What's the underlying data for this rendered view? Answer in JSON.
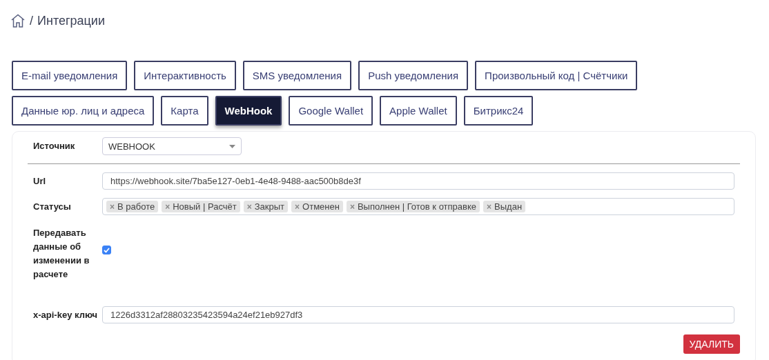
{
  "breadcrumb": {
    "separator": "/",
    "title": "Интеграции"
  },
  "tabs": [
    {
      "label": "E-mail уведомления",
      "selected": false
    },
    {
      "label": "Интерактивность",
      "selected": false
    },
    {
      "label": "SMS уведомления",
      "selected": false
    },
    {
      "label": "Push уведомления",
      "selected": false
    },
    {
      "label": "Произвольный код | Счётчики",
      "selected": false
    },
    {
      "label": "Данные юр. лиц и адреса",
      "selected": false
    },
    {
      "label": "Карта",
      "selected": false
    },
    {
      "label": "WebHook",
      "selected": true
    },
    {
      "label": "Google Wallet",
      "selected": false
    },
    {
      "label": "Apple Wallet",
      "selected": false
    },
    {
      "label": "Битрикс24",
      "selected": false
    }
  ],
  "source": {
    "label": "Источник",
    "value": "WEBHOOK"
  },
  "url": {
    "label": "Url",
    "value": "https://webhook.site/7ba5e127-0eb1-4e48-9488-aac500b8de3f"
  },
  "statuses": {
    "label": "Статусы",
    "tags": [
      {
        "remove": "×",
        "text": "В работе"
      },
      {
        "remove": "×",
        "text": "Новый | Расчёт"
      },
      {
        "remove": "×",
        "text": "Закрыт"
      },
      {
        "remove": "×",
        "text": "Отменен"
      },
      {
        "remove": "×",
        "text": "Выполнен | Готов к отправке"
      },
      {
        "remove": "×",
        "text": "Выдан"
      }
    ]
  },
  "send_changes": {
    "label": "Передавать данные об изменении в расчете",
    "checked": true
  },
  "api_key": {
    "label": "x-api-key ключ",
    "value": "1226d3312af28803235423594a24ef21eb927df3"
  },
  "delete_button": "УДАЛИТЬ"
}
